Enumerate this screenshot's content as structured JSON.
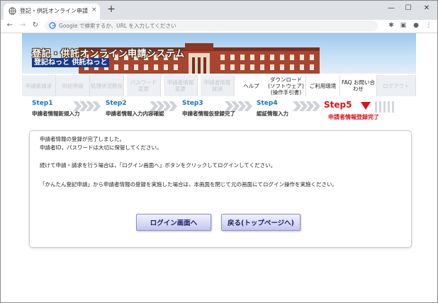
{
  "browser": {
    "tab_title": "登記・供託オンライン申請システム・・",
    "tab_close": "×",
    "new_tab": "+",
    "window_buttons": [
      "—",
      "☐",
      "✕"
    ],
    "omnibox_placeholder": "Google で検索するか、URL を入力してください",
    "icons": [
      "back-icon",
      "forward-icon",
      "reload-icon",
      "google-icon",
      "extensions-icon",
      "sidebar-icon",
      "profile-icon",
      "more-icon"
    ]
  },
  "banner": {
    "title": "登記・供託オンライン申請システム",
    "subtitle": "登記ねっと 供託ねっと"
  },
  "menu": {
    "items": [
      {
        "label": "申請者請求",
        "enabled": false
      },
      {
        "label": "供託申請",
        "enabled": false
      },
      {
        "label": "処理状況照会",
        "enabled": false
      },
      {
        "label": "パスワード 変更",
        "enabled": false
      },
      {
        "label": "申請者情報 変更",
        "enabled": false
      },
      {
        "label": "申請者情報 抹消",
        "enabled": false
      },
      {
        "label": "ヘルプ",
        "enabled": true
      },
      {
        "label": "ダウンロード (ソフトウェア) (操作手引書)",
        "enabled": true
      },
      {
        "label": "ご利用環境",
        "enabled": true
      },
      {
        "label": "FAQ お問い合わせ",
        "enabled": true
      },
      {
        "label": "ログアウト",
        "enabled": false
      }
    ]
  },
  "steps": [
    {
      "label": "Step1",
      "desc": "申請者情報新規入力"
    },
    {
      "label": "Step2",
      "desc": "申請者情報入力内容確認"
    },
    {
      "label": "Step3",
      "desc": "申請者情報仮登録完了"
    },
    {
      "label": "Step4",
      "desc": "認証情報入力"
    },
    {
      "label": "Step5",
      "desc": "申請者情報登録完了"
    }
  ],
  "colors": {
    "accent": "#1a73c8",
    "current_step": "#e0101a",
    "button_text": "#1a1f6b"
  },
  "main": {
    "line1": "申請者情報の登録が完了しました。",
    "line2": "申請者ID，パスワードは大切に保管してください。",
    "line3": "続けて申請・請求を行う場合は，「ログイン画面へ」ボタンをクリックしてログインしてください。",
    "line4": "「かんたん登記申請」から申請者情報の登録を実施した場合は，本画面を閉じて元の画面にてログイン操作を実施ください。",
    "login_button": "ログイン画面へ",
    "back_button": "戻る(トップページへ)"
  }
}
